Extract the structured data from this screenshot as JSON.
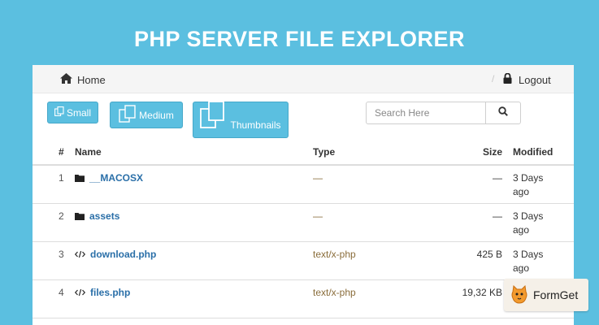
{
  "banner": {
    "title": "PHP SERVER FILE EXPLORER"
  },
  "nav": {
    "home_label": "Home",
    "separator": "/",
    "logout_label": "Logout"
  },
  "view_buttons": {
    "small": "Small",
    "medium": "Medium",
    "thumbnails": "Thumbnails"
  },
  "search": {
    "placeholder": "Search Here",
    "value": ""
  },
  "table": {
    "headers": {
      "num": "#",
      "name": "Name",
      "type": "Type",
      "size": "Size",
      "modified": "Modified"
    },
    "rows": [
      {
        "num": "1",
        "icon": "folder-icon",
        "name": "__MACOSX",
        "type": "—",
        "size": "—",
        "modified": "3 Days ago"
      },
      {
        "num": "2",
        "icon": "folder-icon",
        "name": "assets",
        "type": "—",
        "size": "—",
        "modified": "3 Days ago"
      },
      {
        "num": "3",
        "icon": "code-icon",
        "name": "download.php",
        "type": "text/x-php",
        "size": "425 B",
        "modified": "3 Days ago"
      },
      {
        "num": "4",
        "icon": "code-icon",
        "name": "files.php",
        "type": "text/x-php",
        "size": "19,32 KB",
        "modified": ""
      }
    ]
  },
  "watermark": {
    "text": "FormGet"
  },
  "colors": {
    "background": "#5bbfe0",
    "button": "#5bbfe0",
    "link": "#2a6fa8",
    "type_text": "#8a6d3b"
  }
}
